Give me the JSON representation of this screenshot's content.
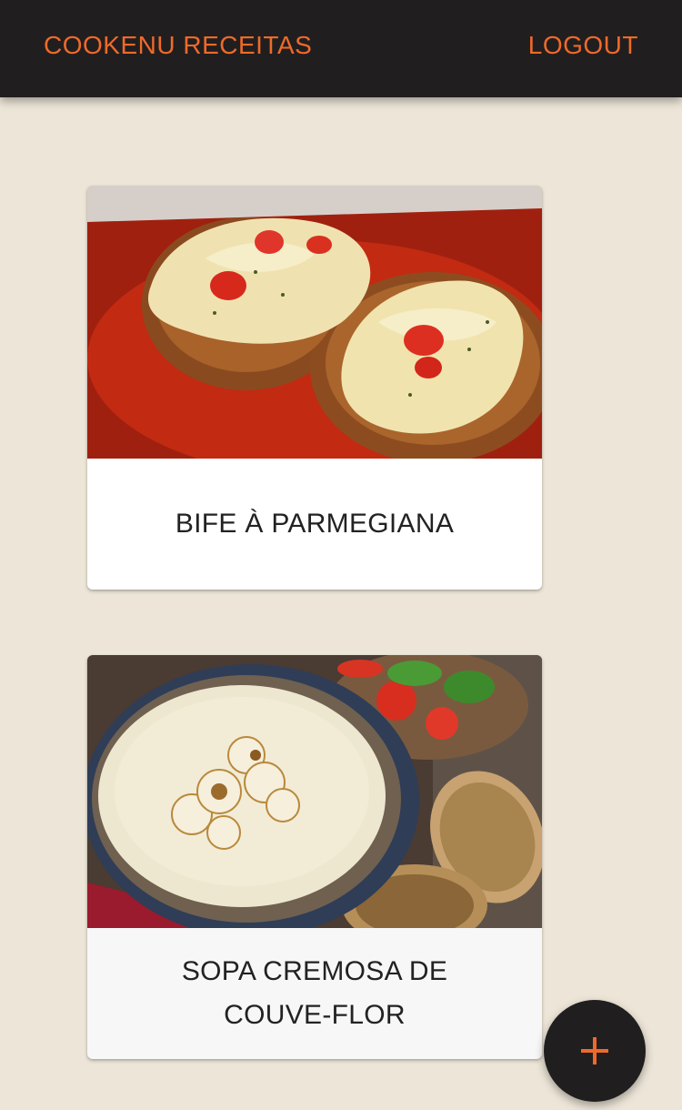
{
  "header": {
    "brand": "COOKENU RECEITAS",
    "logout_label": "LOGOUT"
  },
  "recipes": [
    {
      "title": "BIFE À PARMEGIANA",
      "image": "bife-parmegiana-photo"
    },
    {
      "title": "SOPA CREMOSA DE COUVE-FLOR",
      "image": "sopa-couve-flor-photo"
    }
  ],
  "fab": {
    "icon": "plus-icon"
  },
  "colors": {
    "accent": "#ee6a2a",
    "appbar": "#211e1f",
    "background": "#ede6d8"
  }
}
